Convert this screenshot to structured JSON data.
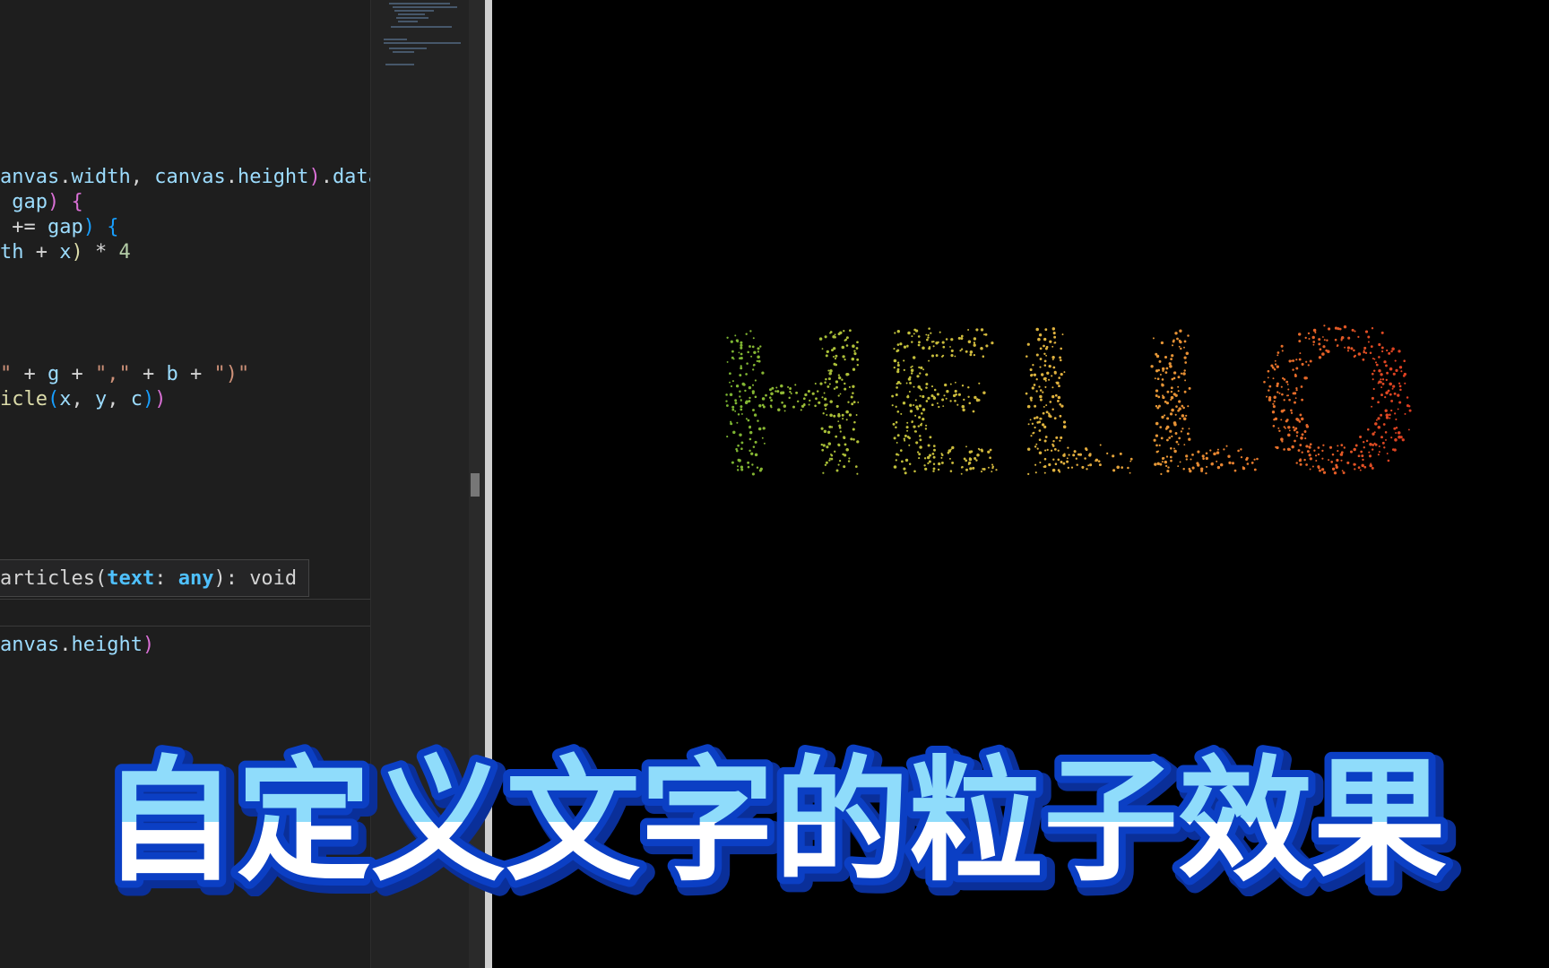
{
  "editor": {
    "lines": [
      [
        [
          "tok-var",
          "anvas"
        ],
        [
          "tok-op",
          "."
        ],
        [
          "tok-var",
          "width"
        ],
        [
          "tok-op",
          ", "
        ],
        [
          "tok-var",
          "canvas"
        ],
        [
          "tok-op",
          "."
        ],
        [
          "tok-var",
          "height"
        ],
        [
          "tok-p1",
          ")"
        ],
        [
          "tok-op",
          "."
        ],
        [
          "tok-var",
          "data"
        ]
      ],
      [
        [
          "tok-op",
          " "
        ],
        [
          "tok-var",
          "gap"
        ],
        [
          "tok-p1",
          ")"
        ],
        [
          "tok-op",
          " "
        ],
        [
          "tok-p1",
          "{"
        ]
      ],
      [
        [
          "tok-op",
          " += "
        ],
        [
          "tok-var",
          "gap"
        ],
        [
          "tok-p2",
          ")"
        ],
        [
          "tok-op",
          " "
        ],
        [
          "tok-p2",
          "{"
        ]
      ],
      [
        [
          "tok-var",
          "th"
        ],
        [
          "tok-op",
          " + "
        ],
        [
          "tok-var",
          "x"
        ],
        [
          "tok-fn",
          ")"
        ],
        [
          "tok-op",
          " * "
        ],
        [
          "tok-num",
          "4"
        ]
      ],
      [
        [
          "tok-str",
          "\""
        ],
        [
          "tok-op",
          " + "
        ],
        [
          "tok-var",
          "g"
        ],
        [
          "tok-op",
          " + "
        ],
        [
          "tok-str",
          "\",\""
        ],
        [
          "tok-op",
          " + "
        ],
        [
          "tok-var",
          "b"
        ],
        [
          "tok-op",
          " + "
        ],
        [
          "tok-str",
          "\")\""
        ]
      ],
      [
        [
          "tok-fn",
          "icle"
        ],
        [
          "tok-p2",
          "("
        ],
        [
          "tok-var",
          "x"
        ],
        [
          "tok-op",
          ", "
        ],
        [
          "tok-var",
          "y"
        ],
        [
          "tok-op",
          ", "
        ],
        [
          "tok-var",
          "c"
        ],
        [
          "tok-p2",
          ")"
        ],
        [
          "tok-p1",
          ")"
        ]
      ],
      [
        [
          "tok-var",
          "anvas"
        ],
        [
          "tok-op",
          "."
        ],
        [
          "tok-var",
          "height"
        ],
        [
          "tok-p1",
          ")"
        ]
      ]
    ],
    "hover_tooltip": {
      "prefix": "articles(",
      "param": "text",
      "colon": ": ",
      "type": "any",
      "suffix": "): void"
    }
  },
  "preview": {
    "particle_text": "HELLO",
    "gradient_colors": [
      "#5fae2e",
      "#b9c23a",
      "#e3b13f",
      "#e8782c",
      "#d8281c"
    ]
  },
  "caption": {
    "text": "自定义文字的粒子效果",
    "fill_light": "#ffffff",
    "fill_blue": "#8fdcfb",
    "outline": "#0b3fc4"
  }
}
